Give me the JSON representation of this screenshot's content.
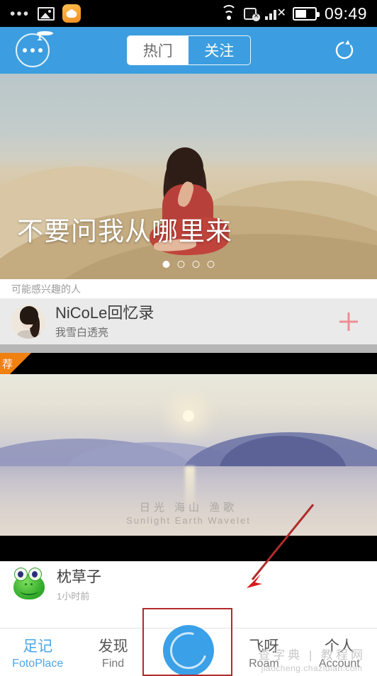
{
  "status_bar": {
    "icons": [
      "more-dots-icon",
      "photo-icon",
      "game-icon",
      "wifi-icon",
      "sim-disabled-icon",
      "signal-off-icon",
      "battery-icon"
    ],
    "time": "09:49"
  },
  "header": {
    "menu_icon": "three-dots-circle-icon",
    "badge_count": "1",
    "tabs": [
      {
        "label": "热门",
        "active": true
      },
      {
        "label": "关注",
        "active": false
      }
    ],
    "refresh_icon": "refresh-icon",
    "background_color": "#3c9ee0"
  },
  "banner": {
    "title": "不要问我从哪里来",
    "dots_total": 4,
    "dots_active_index": 0
  },
  "suggested": {
    "section_title": "可能感兴趣的人",
    "user": {
      "name": "NiCoLe回忆录",
      "subtitle": "我雪白透亮",
      "follow_icon": "plus-icon",
      "follow_color": "#ef8d94"
    }
  },
  "post": {
    "flag_label": "荐",
    "flag_color": "#f08010",
    "watermark_cn": "日光 海山 渔歌",
    "watermark_en": "Sunlight Earth Wavelet",
    "author": {
      "name": "枕草子",
      "time": "1小时前",
      "avatar": "frog-avatar"
    }
  },
  "tabbar": {
    "items": [
      {
        "cn": "足记",
        "en": "FotoPlace",
        "active": true
      },
      {
        "cn": "发现",
        "en": "Find",
        "active": false
      },
      {
        "cn": "",
        "en": "",
        "active": false,
        "icon": "camera-shutter-icon"
      },
      {
        "cn": "飞呀",
        "en": "Roam",
        "active": false
      },
      {
        "cn": "个人",
        "en": "Account",
        "active": false
      }
    ],
    "active_color": "#4aa6e8"
  },
  "annotations": {
    "highlight_target": "camera-shutter-icon",
    "arrow_color": "#b02b2b"
  },
  "site_watermark": {
    "line1": "查字典 | 教程网",
    "line2": "jiaocheng.chazidian.com"
  }
}
